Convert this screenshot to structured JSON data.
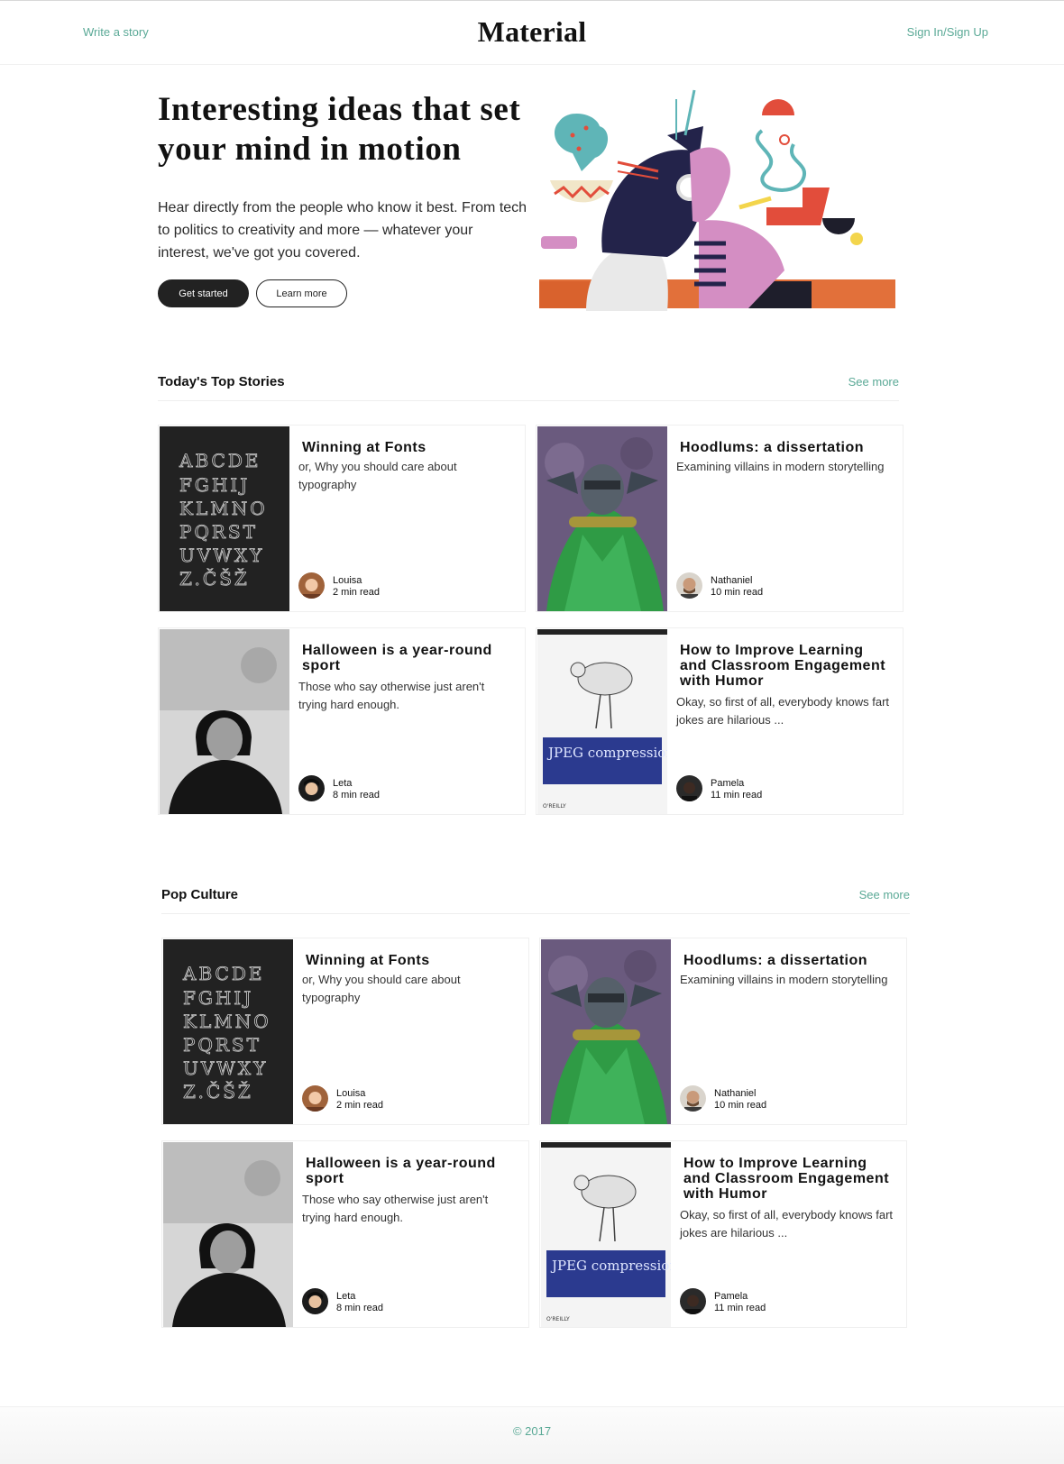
{
  "header": {
    "write_link": "Write a story",
    "brand": "Material",
    "signin_link": "Sign In/Sign Up"
  },
  "hero": {
    "title": "Interesting ideas that set your mind in motion",
    "subtitle": "Hear directly from the people who know it best. From tech to politics to creativity and more — whatever your interest, we've got you covered.",
    "primary_button": "Get started",
    "secondary_button": "Learn more"
  },
  "sections": [
    {
      "title": "Today's Top Stories",
      "see_more": "See more",
      "cards": [
        {
          "title": "Winning at Fonts",
          "desc": "or, Why you should care about typography",
          "author": "Louisa",
          "read_time": "2 min read",
          "thumb": "alphabet-typography"
        },
        {
          "title": "Hoodlums: a dissertation",
          "desc": "Examining villains in modern storytelling",
          "author": "Nathaniel",
          "read_time": "10 min read",
          "thumb": "comic-villain"
        },
        {
          "title": "Halloween is a year-round sport",
          "desc": "Those who say otherwise just aren't trying hard enough.",
          "author": "Leta",
          "read_time": "8 min read",
          "thumb": "vintage-portrait"
        },
        {
          "title": "How to Improve Learning and Classroom Engagement with Humor",
          "desc": "Okay, so first of all, everybody knows fart jokes are hilarious ...",
          "author": "Pamela",
          "read_time": "11 min read",
          "thumb": "jpeg-book-cover",
          "thumb_text": "JPEG compression"
        }
      ]
    },
    {
      "title": "Pop Culture",
      "see_more": "See more",
      "cards": [
        {
          "title": "Winning at Fonts",
          "desc": "or, Why you should care about typography",
          "author": "Louisa",
          "read_time": "2 min read",
          "thumb": "alphabet-typography"
        },
        {
          "title": "Hoodlums: a dissertation",
          "desc": "Examining villains in modern storytelling",
          "author": "Nathaniel",
          "read_time": "10 min read",
          "thumb": "comic-villain"
        },
        {
          "title": "Halloween is a year-round sport",
          "desc": "Those who say otherwise just aren't trying hard enough.",
          "author": "Leta",
          "read_time": "8 min read",
          "thumb": "vintage-portrait"
        },
        {
          "title": "How to Improve Learning and Classroom Engagement with Humor",
          "desc": "Okay, so first of all, everybody knows fart jokes are hilarious ...",
          "author": "Pamela",
          "read_time": "11 min read",
          "thumb": "jpeg-book-cover",
          "thumb_text": "JPEG compression"
        }
      ]
    }
  ],
  "footer": {
    "copyright": "© 2017"
  },
  "colors": {
    "accent": "#5aa996",
    "dark_button": "#222222",
    "alphabet_bg": "#222222"
  }
}
